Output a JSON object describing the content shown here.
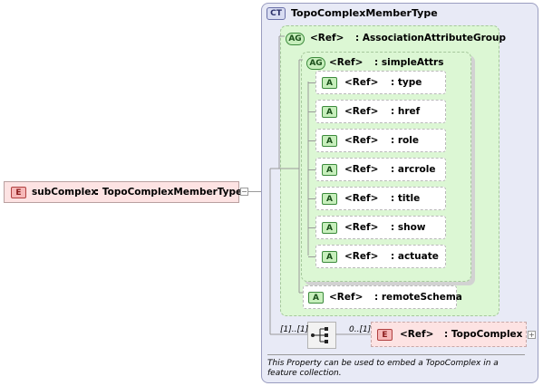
{
  "complex_type": {
    "badge": "CT",
    "name": "TopoComplexMemberType"
  },
  "association_group": {
    "badge": "AG",
    "ref": "<Ref>",
    "name": ": AssociationAttributeGroup"
  },
  "simple_attrs": {
    "badge": "AG",
    "ref": "<Ref>",
    "name": ": simpleAttrs"
  },
  "attributes": [
    {
      "badge": "A",
      "ref": "<Ref>",
      "name": ": type"
    },
    {
      "badge": "A",
      "ref": "<Ref>",
      "name": ": href"
    },
    {
      "badge": "A",
      "ref": "<Ref>",
      "name": ": role"
    },
    {
      "badge": "A",
      "ref": "<Ref>",
      "name": ": arcrole"
    },
    {
      "badge": "A",
      "ref": "<Ref>",
      "name": ": title"
    },
    {
      "badge": "A",
      "ref": "<Ref>",
      "name": ": show"
    },
    {
      "badge": "A",
      "ref": "<Ref>",
      "name": ": actuate"
    }
  ],
  "remote_schema": {
    "badge": "A",
    "ref": "<Ref>",
    "name": ": remoteSchema"
  },
  "root_element": {
    "badge": "E",
    "name": "subComplex",
    "type": ": TopoComplexMemberType"
  },
  "sequence": {
    "left_cardinality": "[1]..[1]",
    "right_cardinality": "0..[1]"
  },
  "topo_element": {
    "badge": "E",
    "ref": "<Ref>",
    "name": ": TopoComplex"
  },
  "documentation": "This Property can be used to embed a TopoComplex in a feature collection."
}
